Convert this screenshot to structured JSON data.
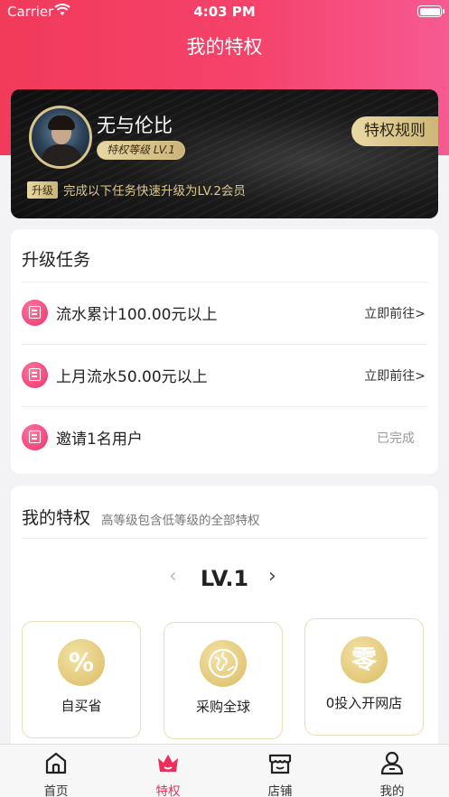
{
  "status_bar": {
    "carrier": "Carrier",
    "time": "4:03 PM"
  },
  "header": {
    "title": "我的特权"
  },
  "member_card": {
    "user_name": "无与伦比",
    "level_badge": "特权等级 LV.1",
    "rules_button": "特权规则",
    "upgrade_tag": "升级",
    "upgrade_text": "完成以下任务快速升级为LV.2会员"
  },
  "tasks": {
    "title": "升级任务",
    "items": [
      {
        "icon": "cash-register-icon",
        "label": "流水累计100.00元以上",
        "action": "立即前往>",
        "completed": false
      },
      {
        "icon": "receipt-icon",
        "label": "上月流水50.00元以上",
        "action": "立即前往>",
        "completed": false
      },
      {
        "icon": "envelope-icon",
        "label": "邀请1名用户",
        "action": "已完成",
        "completed": true
      }
    ]
  },
  "privileges": {
    "title": "我的特权",
    "subtitle": "高等级包含低等级的全部特权",
    "level": "LV.1",
    "prev_glyph": "‹",
    "next_glyph": "›",
    "items": [
      {
        "icon": "percent-icon",
        "glyph": "%",
        "label": "自买省"
      },
      {
        "icon": "globe-icon",
        "glyph": "",
        "label": "采购全球"
      },
      {
        "icon": "zero-badge-icon",
        "glyph": "零",
        "label": "0投入开网店"
      }
    ]
  },
  "tab_bar": {
    "items": [
      {
        "label": "首页",
        "icon": "home-icon",
        "active": false
      },
      {
        "label": "特权",
        "icon": "crown-icon",
        "active": true
      },
      {
        "label": "店铺",
        "icon": "store-icon",
        "active": false
      },
      {
        "label": "我的",
        "icon": "user-icon",
        "active": false
      }
    ]
  },
  "colors": {
    "brand": "#f23a5a",
    "gold": "#d9c58c",
    "active_tab": "#ee2e5a"
  }
}
